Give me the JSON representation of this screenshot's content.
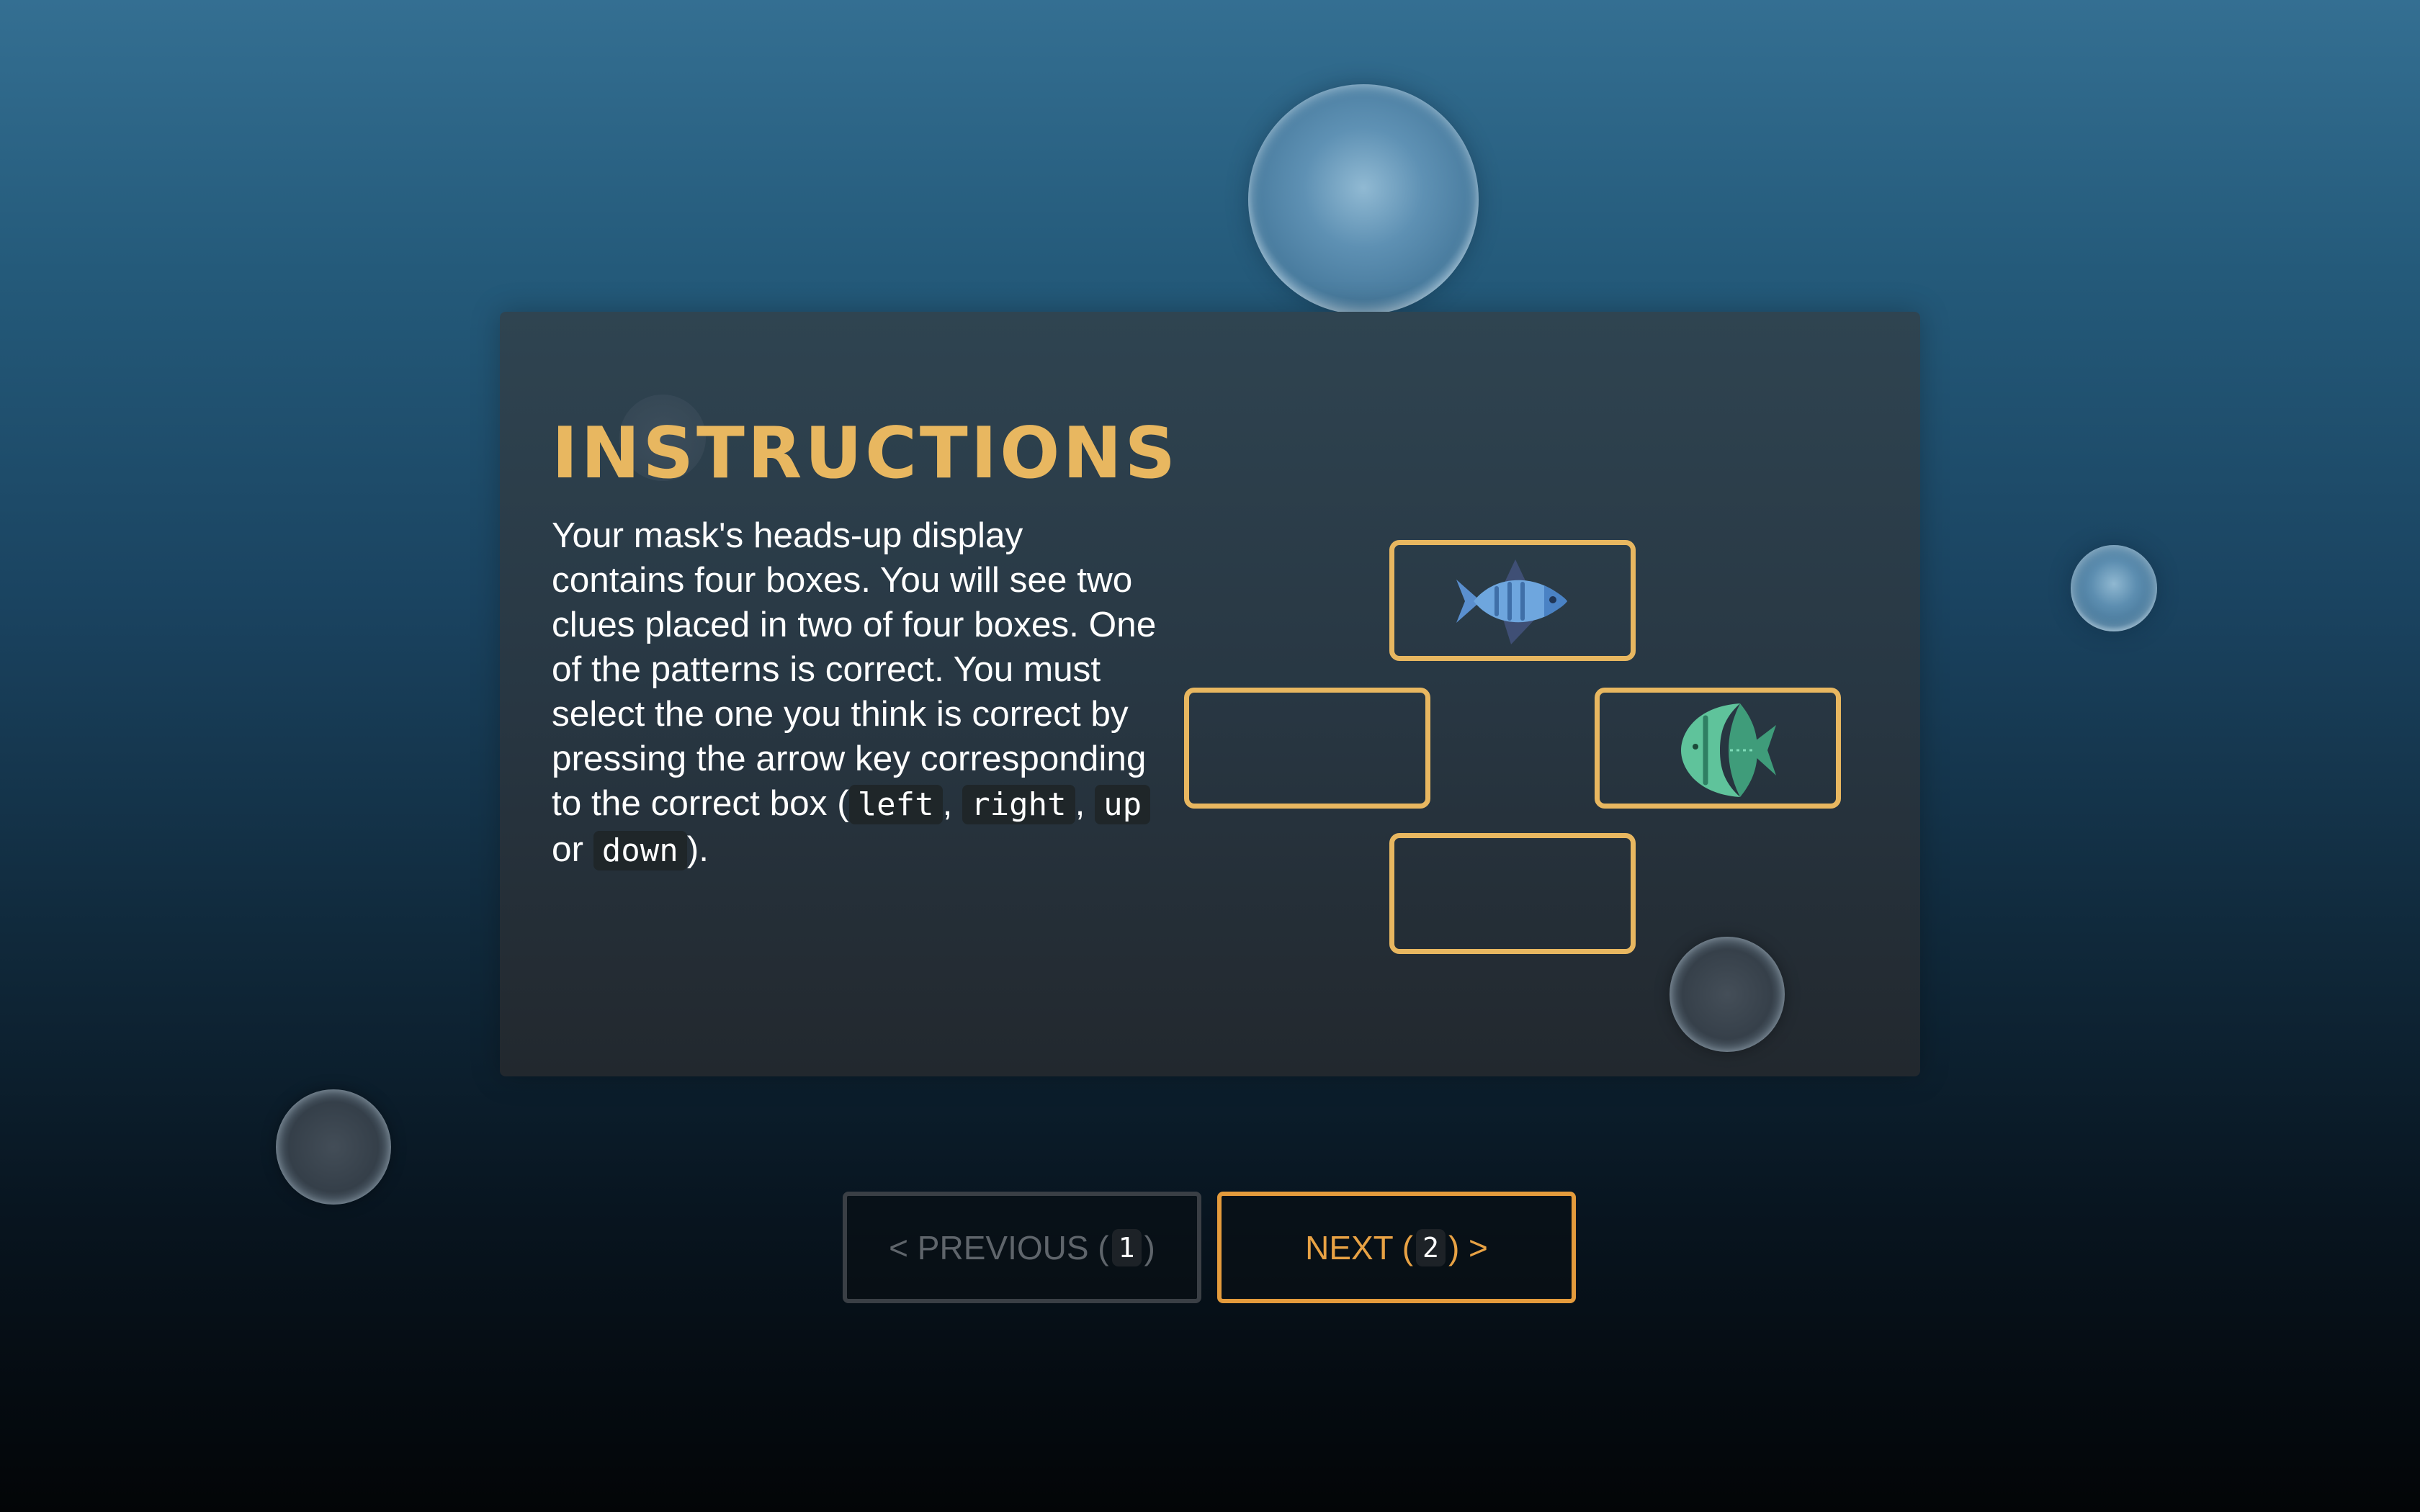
{
  "instructions": {
    "title": "INSTRUCTIONS",
    "text_before": "Your mask's heads-up display contains four boxes. You will see two clues placed in two of four boxes. One of the patterns is correct. You must select the one you think is correct by pressing the arrow key corresponding to the correct box (",
    "keys": [
      "left",
      "right",
      "up",
      "down"
    ],
    "sep_comma": ",",
    "sep_or": "or",
    "text_after": ")."
  },
  "boxes": {
    "up": "fish-icon",
    "left": "",
    "right": "angelfish-icon",
    "down": ""
  },
  "nav": {
    "prev_label": "< PREVIOUS (",
    "prev_key": "1",
    "prev_close": ")",
    "next_label": "NEXT (",
    "next_key": "2",
    "next_close": ") >"
  },
  "colors": {
    "accent": "#e8b760",
    "next_border": "#e49b3c",
    "card_bg": "#283743"
  }
}
